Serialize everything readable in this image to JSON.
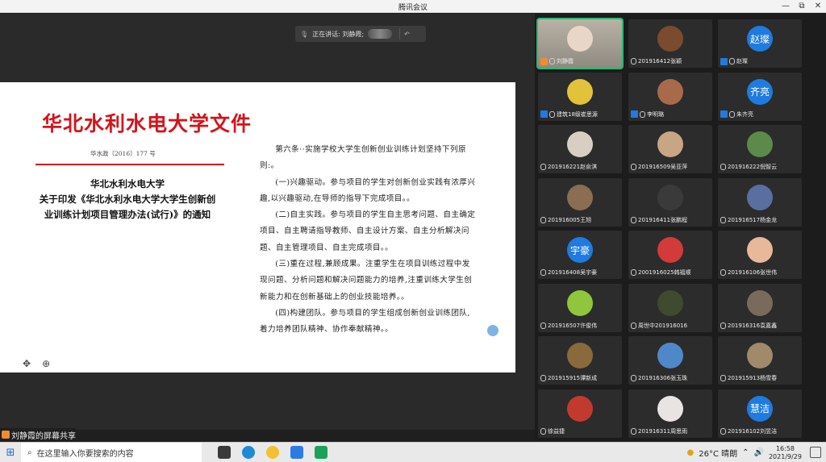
{
  "window": {
    "title": "腾讯会议",
    "min": "—",
    "restore": "⧉",
    "close": "✕"
  },
  "speaker_bar": {
    "label": "正在讲话: 刘静霞;"
  },
  "document": {
    "red_head": "华北水利水电大学文件",
    "doc_no": "华水政〔2016〕177 号",
    "left_title": [
      "华北水利水电大学",
      "关于印发《华北水利水电大学大学生创新创",
      "业训练计划项目管理办法(试行)》的通知"
    ],
    "right_paragraphs": [
      "第六条··实施学校大学生创新创业训练计划坚持下列原则:。",
      "(一)兴趣驱动。参与项目的学生对创新创业实践有浓厚兴趣,以兴趣驱动,在导师的指导下完成项目。。",
      "(二)自主实践。参与项目的学生自主思考问题、自主确定项目、自主聘请指导教师、自主设计方案、自主分析解决问题、自主管理项目、自主完成项目。。",
      "(三)重在过程,兼顾成果。注重学生在项目训练过程中发现问题、分析问题和解决问题能力的培养,注重训练大学生创新能力和在创新基础上的创业技能培养。。",
      "(四)构建团队。参与项目的学生组成创新创业训练团队,着力培养团队精神、协作奉献精神。。"
    ]
  },
  "share_label": "刘静霞的屏幕共享",
  "participants": [
    {
      "name": "刘静霞",
      "avatar": "",
      "color": "#b9b2a6",
      "host": "o"
    },
    {
      "name": "201916412张颖",
      "avatar": "",
      "color": "#7a4b2e"
    },
    {
      "name": "赵璨",
      "avatar": "赵璨",
      "color": "#1e7be0",
      "host": "b"
    },
    {
      "name": "建筑18级崔思源",
      "avatar": "",
      "color": "#e2c23a",
      "host": "b"
    },
    {
      "name": "李明璐",
      "avatar": "",
      "color": "#a86a4b",
      "host": "b"
    },
    {
      "name": "朱齐亮",
      "avatar": "齐亮",
      "color": "#1e7be0",
      "host": "b"
    },
    {
      "name": "201916221赵俞淇",
      "avatar": "",
      "color": "#d8cfc2"
    },
    {
      "name": "201916509吴亚萍",
      "avatar": "",
      "color": "#c8a584"
    },
    {
      "name": "201916222倪智云",
      "avatar": "",
      "color": "#5c8a4a"
    },
    {
      "name": "201916005王旭",
      "avatar": "",
      "color": "#8a6d52"
    },
    {
      "name": "201916411张鹏程",
      "avatar": "",
      "color": "#3a3a3a"
    },
    {
      "name": "201916517杨金龙",
      "avatar": "",
      "color": "#5a6fa0"
    },
    {
      "name": "201916408吴宇豪",
      "avatar": "宇豪",
      "color": "#1e7be0"
    },
    {
      "name": "2001916025韩福顺",
      "avatar": "",
      "color": "#d33a3a"
    },
    {
      "name": "201916106张世伟",
      "avatar": "",
      "color": "#e7b99a"
    },
    {
      "name": "201916507许俊伟",
      "avatar": "",
      "color": "#8fc63c"
    },
    {
      "name": "周世中201916016",
      "avatar": "",
      "color": "#3f4a2e"
    },
    {
      "name": "201916316袁嘉鑫",
      "avatar": "",
      "color": "#7a6a5c"
    },
    {
      "name": "201915915谭新成",
      "avatar": "",
      "color": "#8a6a3a"
    },
    {
      "name": "201916306张玉珠",
      "avatar": "",
      "color": "#4f88c8"
    },
    {
      "name": "201915913杨雪春",
      "avatar": "",
      "color": "#a08a6a"
    },
    {
      "name": "徐益捷",
      "avatar": "",
      "color": "#c23a2f"
    },
    {
      "name": "201916311周思雨",
      "avatar": "",
      "color": "#e9e4e4"
    },
    {
      "name": "201916102刘昱洁",
      "avatar": "慧洁",
      "color": "#1e7be0"
    }
  ],
  "taskbar": {
    "search_placeholder": "在这里输入你要搜索的内容",
    "weather": "26°C 晴朗",
    "time": "16:58",
    "date": "2021/9/29"
  }
}
